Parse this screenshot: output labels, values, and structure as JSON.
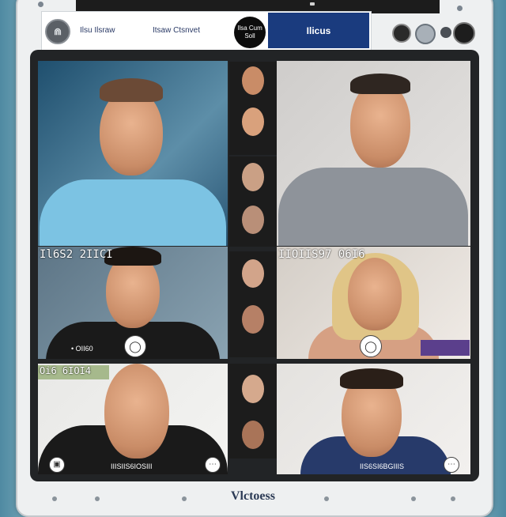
{
  "header": {
    "app_icon_glyph": "⋒",
    "label_1": "Ilsu Ilsraw",
    "label_2": "Itsaw Ctsnvet",
    "logo_text": "Ilsa Cum Soll",
    "brand_text": "Ilicus",
    "controls": [
      "camera-icon",
      "mic-icon",
      "record-icon",
      "settings-icon"
    ]
  },
  "tiles": {
    "top_left": {},
    "top_right": {},
    "middle_left": {
      "label": "Il6S2 2IICI",
      "caption": "• OII60"
    },
    "middle_right": {
      "label": "IIOIIS97 06I6"
    },
    "bottom_left": {
      "label": "Oi6 6IOI4",
      "caption": "IIISIIS6IOSIII"
    },
    "bottom_right": {
      "caption": "IIS6SI6BGIIIS"
    }
  },
  "footer": {
    "title": "Vlctoess"
  },
  "colors": {
    "brand": "#1a3b7e",
    "screen": "#222426",
    "accent_purple": "#5b3f8c"
  }
}
